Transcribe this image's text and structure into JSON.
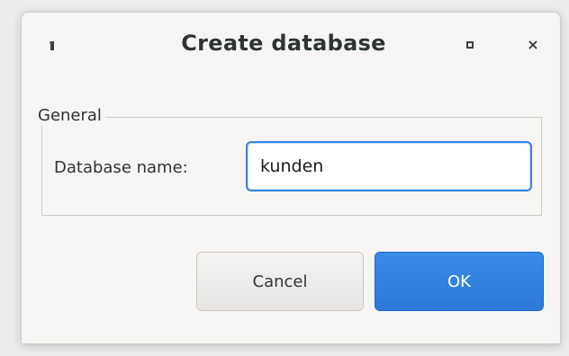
{
  "window": {
    "title": "Create database",
    "menu_icon": "window-menu-icon",
    "maximize_icon": "maximize-icon",
    "close_icon": "close-icon",
    "close_glyph": "×"
  },
  "group": {
    "legend": "General",
    "field_label": "Database name:",
    "field_value": "kunden"
  },
  "buttons": {
    "cancel_label": "Cancel",
    "ok_label": "OK"
  },
  "colors": {
    "accent": "#3584e4",
    "ok_button": "#3584e4",
    "dialog_bg": "#f6f5f4"
  }
}
